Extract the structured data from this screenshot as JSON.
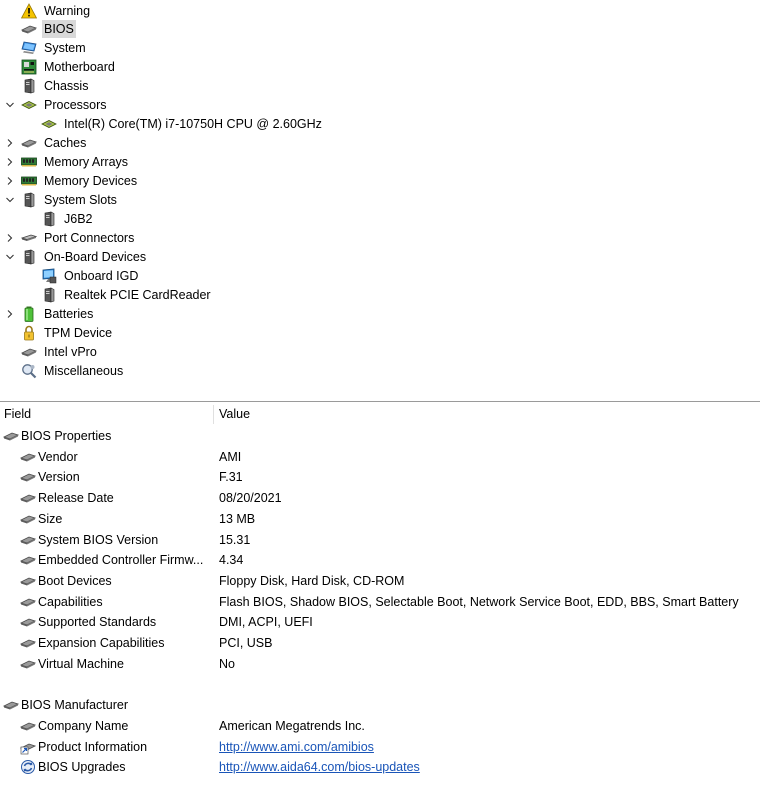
{
  "tree": {
    "items": [
      {
        "label": "Warning",
        "icon": "warning-icon",
        "level": 0,
        "expander": "none",
        "selected": false
      },
      {
        "label": "BIOS",
        "icon": "chip-icon",
        "level": 0,
        "expander": "none",
        "selected": true
      },
      {
        "label": "System",
        "icon": "computer-icon",
        "level": 0,
        "expander": "none",
        "selected": false
      },
      {
        "label": "Motherboard",
        "icon": "motherboard-icon",
        "level": 0,
        "expander": "none",
        "selected": false
      },
      {
        "label": "Chassis",
        "icon": "tower-icon",
        "level": 0,
        "expander": "none",
        "selected": false
      },
      {
        "label": "Processors",
        "icon": "cpu-icon",
        "level": 0,
        "expander": "expanded",
        "selected": false
      },
      {
        "label": "Intel(R) Core(TM) i7-10750H CPU @ 2.60GHz",
        "icon": "cpu-icon",
        "level": 1,
        "expander": "none",
        "selected": false
      },
      {
        "label": "Caches",
        "icon": "chip-icon",
        "level": 0,
        "expander": "collapsed",
        "selected": false
      },
      {
        "label": "Memory Arrays",
        "icon": "memory-icon",
        "level": 0,
        "expander": "collapsed",
        "selected": false
      },
      {
        "label": "Memory Devices",
        "icon": "memory-icon",
        "level": 0,
        "expander": "collapsed",
        "selected": false
      },
      {
        "label": "System Slots",
        "icon": "tower-icon",
        "level": 0,
        "expander": "expanded",
        "selected": false
      },
      {
        "label": "J6B2",
        "icon": "tower-icon",
        "level": 1,
        "expander": "none",
        "selected": false
      },
      {
        "label": "Port Connectors",
        "icon": "connector-icon",
        "level": 0,
        "expander": "collapsed",
        "selected": false
      },
      {
        "label": "On-Board Devices",
        "icon": "tower-icon",
        "level": 0,
        "expander": "expanded",
        "selected": false
      },
      {
        "label": "Onboard IGD",
        "icon": "display-icon",
        "level": 1,
        "expander": "none",
        "selected": false
      },
      {
        "label": "Realtek PCIE CardReader",
        "icon": "tower-icon",
        "level": 1,
        "expander": "none",
        "selected": false
      },
      {
        "label": "Batteries",
        "icon": "battery-icon",
        "level": 0,
        "expander": "collapsed",
        "selected": false
      },
      {
        "label": "TPM Device",
        "icon": "lock-icon",
        "level": 0,
        "expander": "none",
        "selected": false
      },
      {
        "label": "Intel vPro",
        "icon": "chip-icon",
        "level": 0,
        "expander": "none",
        "selected": false
      },
      {
        "label": "Miscellaneous",
        "icon": "magnifier-icon",
        "level": 0,
        "expander": "none",
        "selected": false
      }
    ]
  },
  "grid": {
    "columns": {
      "field": "Field",
      "value": "Value"
    },
    "rows": [
      {
        "kind": "group",
        "field": "BIOS Properties",
        "icon": "chip-icon",
        "value": ""
      },
      {
        "kind": "item",
        "field": "Vendor",
        "icon": "chip-icon",
        "value": "AMI"
      },
      {
        "kind": "item",
        "field": "Version",
        "icon": "chip-icon",
        "value": "F.31"
      },
      {
        "kind": "item",
        "field": "Release Date",
        "icon": "chip-icon",
        "value": "08/20/2021"
      },
      {
        "kind": "item",
        "field": "Size",
        "icon": "chip-icon",
        "value": "13 MB"
      },
      {
        "kind": "item",
        "field": "System BIOS Version",
        "icon": "chip-icon",
        "value": "15.31"
      },
      {
        "kind": "item",
        "field": "Embedded Controller Firmw...",
        "icon": "chip-icon",
        "value": "4.34"
      },
      {
        "kind": "item",
        "field": "Boot Devices",
        "icon": "chip-icon",
        "value": "Floppy Disk, Hard Disk, CD-ROM"
      },
      {
        "kind": "item",
        "field": "Capabilities",
        "icon": "chip-icon",
        "value": "Flash BIOS, Shadow BIOS, Selectable Boot, Network Service Boot, EDD, BBS, Smart Battery"
      },
      {
        "kind": "item",
        "field": "Supported Standards",
        "icon": "chip-icon",
        "value": "DMI, ACPI, UEFI"
      },
      {
        "kind": "item",
        "field": "Expansion Capabilities",
        "icon": "chip-icon",
        "value": "PCI, USB"
      },
      {
        "kind": "item",
        "field": "Virtual Machine",
        "icon": "chip-icon",
        "value": "No"
      },
      {
        "kind": "blank",
        "field": "",
        "icon": "",
        "value": ""
      },
      {
        "kind": "group",
        "field": "BIOS Manufacturer",
        "icon": "chip-icon",
        "value": ""
      },
      {
        "kind": "item",
        "field": "Company Name",
        "icon": "chip-icon",
        "value": "American Megatrends Inc."
      },
      {
        "kind": "item",
        "field": "Product Information",
        "icon": "link-chip-icon",
        "value": "http://www.ami.com/amibios",
        "link": true
      },
      {
        "kind": "item",
        "field": "BIOS Upgrades",
        "icon": "update-icon",
        "value": "http://www.aida64.com/bios-updates",
        "link": true
      }
    ]
  }
}
